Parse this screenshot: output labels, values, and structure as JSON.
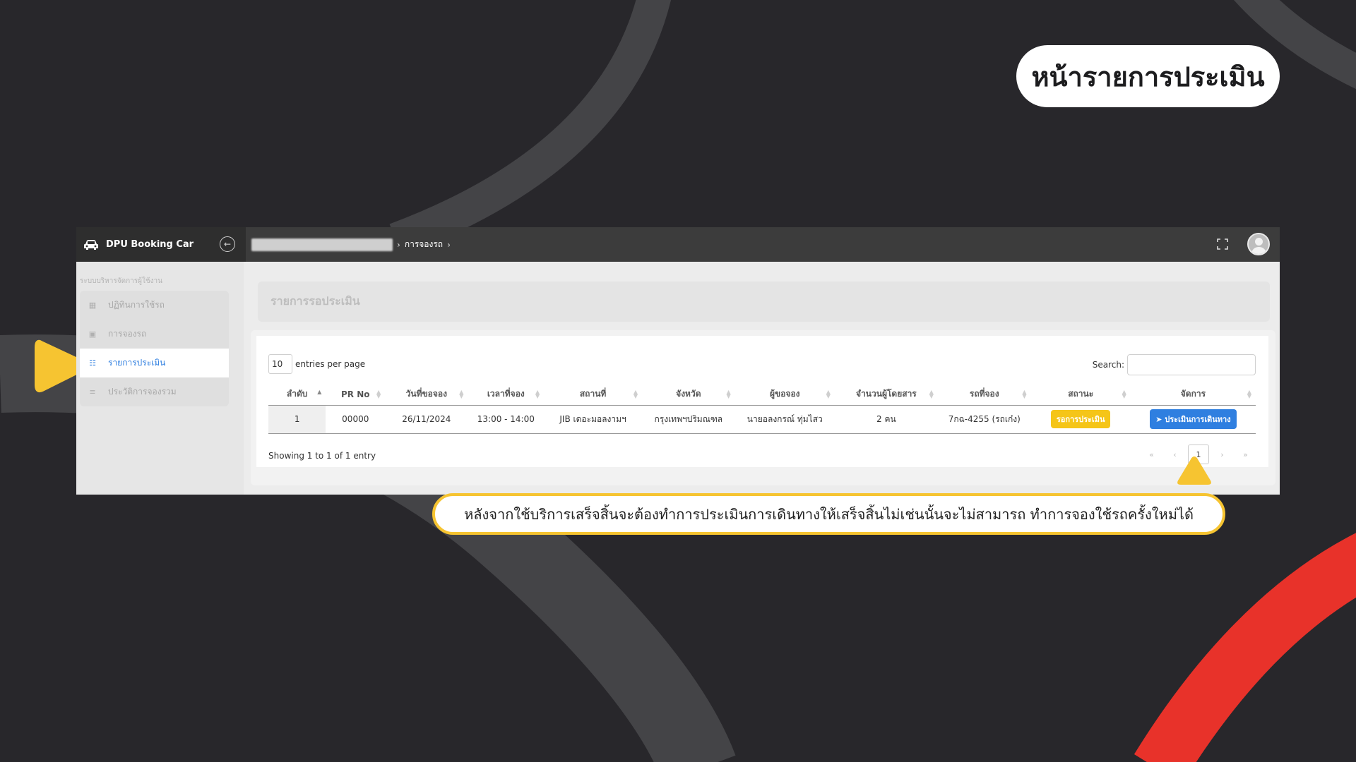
{
  "slide_title": "หน้ารายการประเมิน",
  "callout_text": "หลังจากใช้บริการเสร็จสิ้นจะต้องทำการประเมินการเดินทางให้เสร็จสิ้นไม่เช่นนั้นจะไม่สามารถ ทำการจองใช้รถครั้งใหม่ได้",
  "colors": {
    "background": "#28272b",
    "accent_yellow": "#f6c431",
    "accent_red": "#e8322a",
    "primary_blue": "#2f7fe0"
  },
  "app": {
    "brand": "DPU Booking Car",
    "breadcrumb": {
      "current": "การจองรถ"
    },
    "sidebar": {
      "caption": "ระบบบริหารจัดการผู้ใช้งาน",
      "items": [
        {
          "label": "ปฏิทินการใช้รถ",
          "icon": "calendar-icon"
        },
        {
          "label": "การจองรถ",
          "icon": "booking-icon"
        },
        {
          "label": "รายการประเมิน",
          "icon": "list-icon",
          "active": true
        },
        {
          "label": "ประวัติการจองรวม",
          "icon": "history-icon"
        }
      ]
    },
    "page_title": "รายการรอประเมิน",
    "table_controls": {
      "per_page_value": "10",
      "per_page_label": "entries per page",
      "search_label": "Search:"
    },
    "table": {
      "columns": [
        "ลำดับ",
        "PR No",
        "วันที่ขอจอง",
        "เวลาที่จอง",
        "สถานที่",
        "จังหวัด",
        "ผู้ขอจอง",
        "จำนวนผู้โดยสาร",
        "รถที่จอง",
        "สถานะ",
        "จัดการ"
      ],
      "rows": [
        {
          "no": "1",
          "pr_no": "00000",
          "date": "26/11/2024",
          "time": "13:00 - 14:00",
          "place": "JIB เดอะมอลงามฯ",
          "province": "กรุงเทพฯปริมณฑล",
          "requester": "นายอลงกรณ์ ทุ่มไสว",
          "passengers": "2 คน",
          "car": "7กฉ-4255 (รถเก๋ง)",
          "status": "รอการประเมิน",
          "action": "ประเมินการเดินทาง"
        }
      ]
    },
    "showing_text": "Showing 1 to 1 of 1 entry",
    "pagination": {
      "first": "«",
      "prev": "‹",
      "current": "1",
      "next": "›",
      "last": "»"
    }
  }
}
